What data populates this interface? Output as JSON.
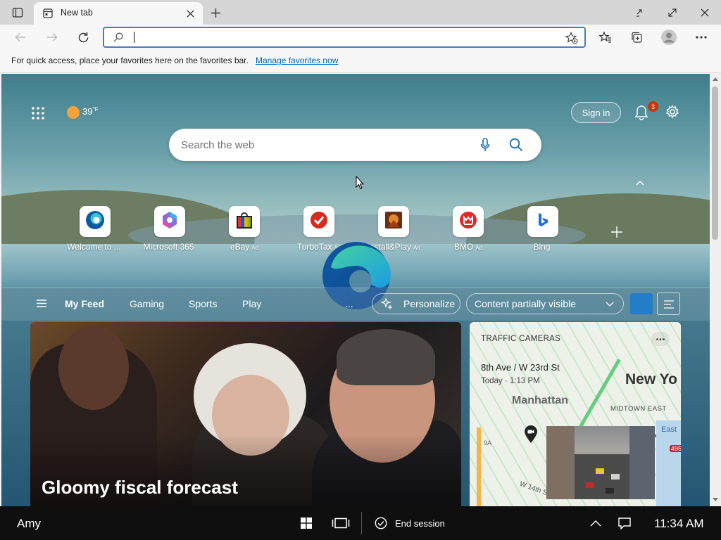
{
  "tab": {
    "title": "New tab"
  },
  "favbar": {
    "message": "For quick access, place your favorites here on the favorites bar.",
    "link": "Manage favorites now"
  },
  "omnibox": {
    "value": ""
  },
  "page": {
    "weather": {
      "temp": "39",
      "unit": "°F"
    },
    "sign_in": "Sign in",
    "notification_count": "3",
    "search": {
      "placeholder": "Search the web"
    },
    "quick_links": [
      {
        "label": "Welcome to ...",
        "ad": "",
        "icon": "edge-icon"
      },
      {
        "label": "Microsoft 365",
        "ad": "",
        "icon": "microsoft-365-icon"
      },
      {
        "label": "eBay",
        "ad": "Ad",
        "icon": "ebay-icon"
      },
      {
        "label": "TurboTax",
        "ad": "Ad",
        "icon": "turbotax-icon"
      },
      {
        "label": "Install&Play",
        "ad": "Ad",
        "icon": "install-play-icon"
      },
      {
        "label": "BMO",
        "ad": "Ad",
        "icon": "bmo-icon"
      },
      {
        "label": "Bing",
        "ad": "",
        "icon": "bing-icon"
      }
    ],
    "feed_nav": {
      "items": [
        "My Feed",
        "Gaming",
        "Sports",
        "Play"
      ],
      "more": "...",
      "personalize": "Personalize",
      "content_select": "Content partially visible"
    },
    "hero": {
      "headline": "Gloomy fiscal forecast"
    },
    "traffic": {
      "heading": "TRAFFIC CAMERAS",
      "location": "8th Ave / W 23rd St",
      "time": "Today · 1:13 PM",
      "map_labels": {
        "city": "New Yo",
        "borough": "Manhattan",
        "area": "MIDTOWN EAST",
        "east": "East",
        "street": "W 14th St",
        "route": "495",
        "route2": "9A"
      }
    }
  },
  "taskbar": {
    "user": "Amy",
    "end_session": "End session",
    "time": "11:34 AM"
  },
  "colors": {
    "accent": "#0f6cbd",
    "link": "#0066b4",
    "badge": "#c4380b"
  }
}
